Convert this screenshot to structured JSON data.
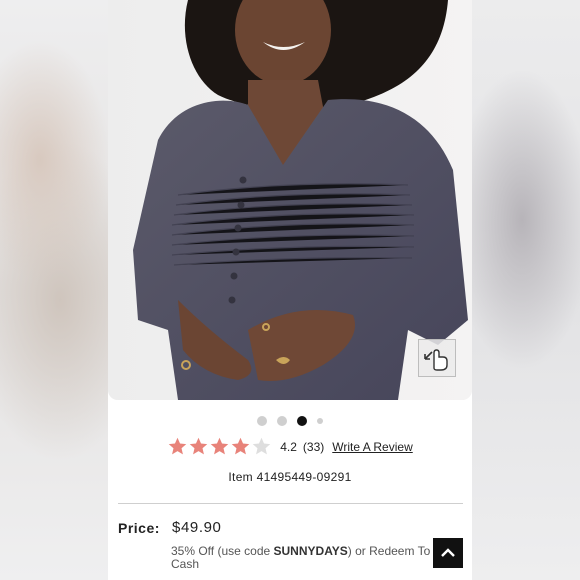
{
  "product": {
    "rating_value": "4.2",
    "rating_count": "(33)",
    "rating_fraction": 0.84,
    "write_review": "Write A Review",
    "item_number": "Item 41495449-09291",
    "price_label": "Price:",
    "price": "$49.90",
    "promo_prefix": "35% Off (use code ",
    "promo_code": "SUNNYDAYS",
    "promo_suffix": ") or Redeem To",
    "promo_line2": "Cash"
  },
  "carousel": {
    "total_dots": 4,
    "active_index": 2
  },
  "colors": {
    "star": "#e8837a",
    "star_empty": "#d9d9d9",
    "dress": "#4e4d5c",
    "accent_button": "#111111"
  },
  "icons": {
    "zoom": "expand-hand-icon",
    "back_to_top": "chevron-up-icon",
    "star": "star-icon"
  }
}
